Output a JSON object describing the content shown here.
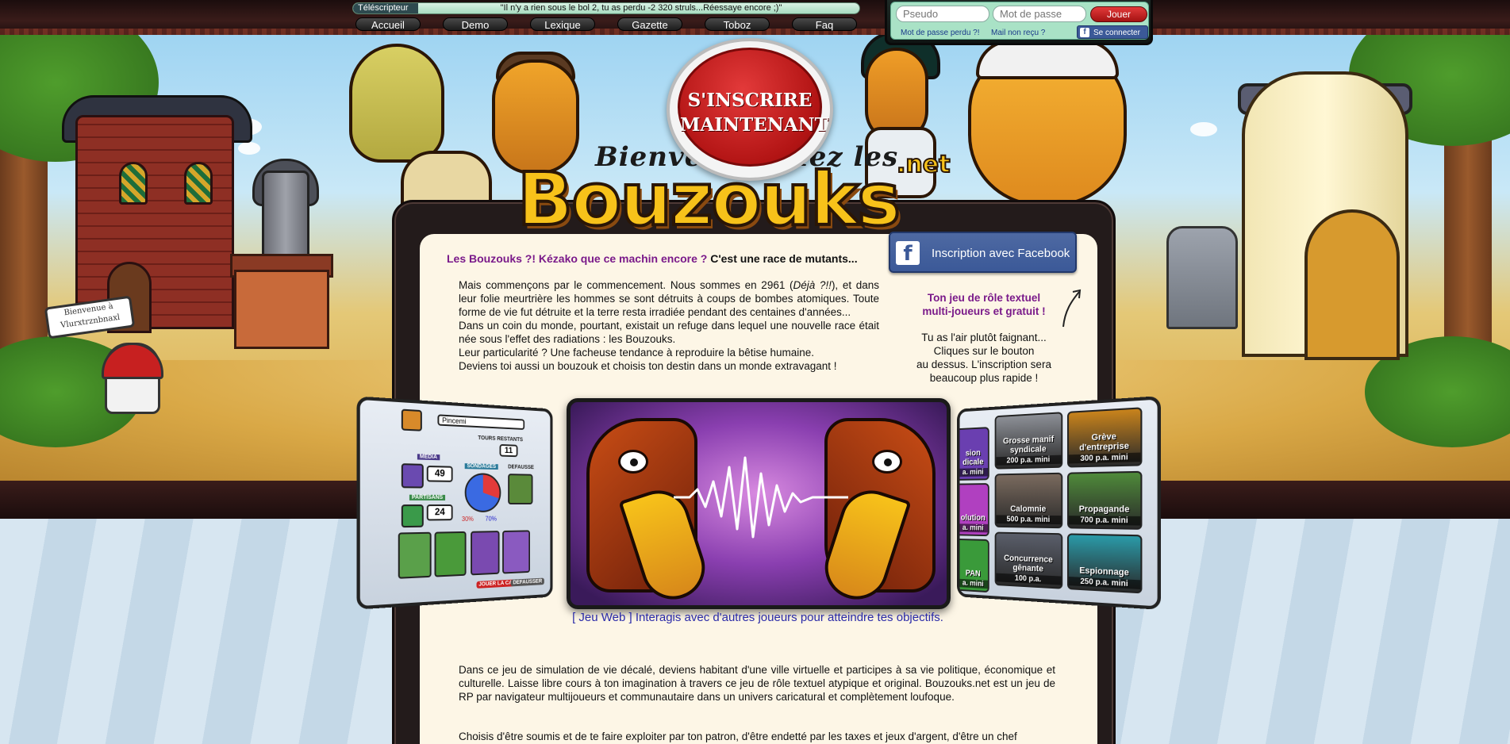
{
  "ticker": {
    "label": "Téléscripteur",
    "message": "\"Il n'y a rien sous le bol 2, tu as perdu -2 320 struls...Réessaye encore ;)\""
  },
  "nav": {
    "items": [
      "Accueil",
      "Demo",
      "Lexique",
      "Gazette",
      "Toboz",
      "Faq"
    ]
  },
  "login": {
    "pseudo_placeholder": "Pseudo",
    "password_placeholder": "Mot de passe",
    "submit_label": "Jouer",
    "lost_password": "Mot de passe perdu ?!",
    "mail_not_received": "Mail non reçu ?",
    "facebook_connect": "Se connecter"
  },
  "banner": {
    "signup_line1": "S'INSCRIRE",
    "signup_line2": "MAINTENANT",
    "logo_subtitle": "Bienvenue chez les",
    "logo_title": "Bouzouks",
    "logo_suffix": ".net",
    "sign_text": "Bienvenue à Vlurxtrznbnaxl"
  },
  "intro": {
    "question": "Les Bouzouks ?! Kézako que ce machin encore ?",
    "answer": "C'est une race de mutants...",
    "paragraph_html_parts": [
      "Mais commençons par le commencement. Nous sommes en 2961 (",
      "Déjà ?!!",
      "), et dans leur folie meurtrière les hommes se sont détruits à coups de bombes atomiques. Toute forme de vie fut détruite et la terre resta irradiée pendant des centaines d'années...",
      "Dans un coin du monde, pourtant, existait un refuge dans lequel une nouvelle race était née sous l'effet des radiations : les Bouzouks.",
      "Leur particularité ? Une facheuse tendance à reproduire la bêtise humaine.",
      "Deviens toi aussi un bouzouk et choisis ton destin dans un monde extravagant !"
    ]
  },
  "facebook_signup": {
    "prefix": "Inscription",
    "connector": "avec",
    "brand": "Facebook"
  },
  "sidebar": {
    "tagline_line1": "Ton jeu de rôle textuel",
    "tagline_line2": "multi-joueurs et gratuit !",
    "lazy_lines": [
      "Tu as l'air plutôt faignant...",
      "Cliques sur le bouton",
      "au dessus. L'inscription sera",
      "beaucoup plus rapide !"
    ]
  },
  "carousel": {
    "left_panel": {
      "name_field": "Pincemi",
      "tours_label": "TOURS RESTANTS",
      "tours_value": "11",
      "media_label": "MEDIA",
      "media_value": "49",
      "partisans_label": "PARTISANS",
      "partisans_value": "24",
      "sondages_label": "SONDAGES",
      "sondage_left": "30%",
      "sondage_right": "70%",
      "defausse_label": "DEFAUSSE",
      "jouer_label": "JOUER LA CARTE",
      "defausser_label": "DEFAUSSER"
    },
    "right_tiles": [
      {
        "name": "Grosse manif syndicale",
        "cost": "200 p.a. mini",
        "color": "#8c8f96"
      },
      {
        "name": "Grève d'entreprise",
        "cost": "300 p.a. mini",
        "color": "#c8831c"
      },
      {
        "name": "Calomnie",
        "cost": "500 p.a. mini",
        "color": "#7a6a5e"
      },
      {
        "name": "Propagande",
        "cost": "700 p.a. mini",
        "color": "#4f8a3a"
      },
      {
        "name": "Concurrence gênante",
        "cost": "100 p.a.",
        "color": "#5a5e6a"
      },
      {
        "name": "Espionnage",
        "cost": "250 p.a. mini",
        "color": "#2a9aa8"
      }
    ],
    "right_partial_tiles": [
      {
        "name": "sion dicale",
        "cost": "a. mini",
        "color": "#6a3fb0"
      },
      {
        "name": "olution",
        "cost": "a. mini",
        "color": "#b040c0"
      },
      {
        "name": "PAN",
        "cost": "a. mini",
        "color": "#3a9a3a"
      }
    ],
    "caption": "[ Jeu Web ] Interagis avec d'autres joueurs pour atteindre tes objectifs."
  },
  "body": {
    "paragraph1": "Dans ce jeu de simulation de vie décalé, deviens habitant d'une ville virtuelle et participes à sa vie politique, économique et culturelle. Laisse libre cours à ton imagination à travers ce jeu de rôle textuel atypique et original. Bouzouks.net est un jeu de RP par navigateur multijoueurs et communautaire dans un univers caricatural et complètement loufoque.",
    "paragraph2": "Choisis d'être soumis et de te faire exploiter par ton patron, d'être endetté par les taxes et jeux d'argent, d'être un chef"
  },
  "colors": {
    "accent_purple": "#7a1a8a",
    "signup_red": "#b21414",
    "facebook_blue": "#3b5998",
    "caption_blue": "#2a2aa8",
    "panel_bg": "#fdf6e6"
  }
}
